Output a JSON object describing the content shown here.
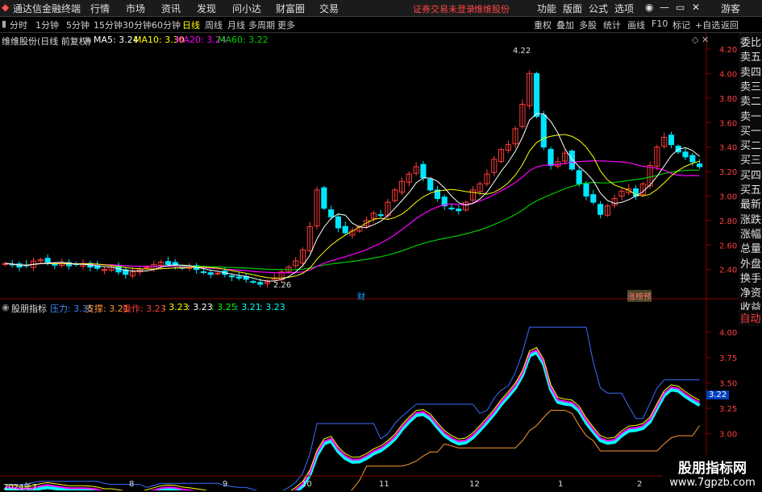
{
  "app": {
    "title": "通达信金融终端"
  },
  "menu": [
    "行情",
    "市场",
    "资讯",
    "发现",
    "问小达",
    "财富圈",
    "交易"
  ],
  "status_notice": "证券交易未登录",
  "stock_name": "维维股份",
  "menu_right": [
    "功能",
    "版面",
    "公式",
    "选项"
  ],
  "guest": "游客",
  "periods": [
    "分时",
    "1分钟",
    "5分钟",
    "15分钟",
    "30分钟",
    "60分钟",
    "日线",
    "周线",
    "月线",
    "多周期",
    "更多"
  ],
  "active_period": "日线",
  "tools": [
    "重权",
    "叠加",
    "多股",
    "统计",
    "画线",
    "F10",
    "标记",
    "+自选",
    "返回"
  ],
  "main_legend": {
    "title": "维维股份(日线 前复权)",
    "ma5": "MA5: 3.24",
    "ma10": "MA10: 3.30",
    "ma20": "MA20: 3.24",
    "ma60": "MA60: 3.22"
  },
  "sub_legend": {
    "title": "股朋指标",
    "pressure": "压力: 3.35",
    "support": "支撑: 3.21",
    "operate": "操作: 3.23",
    "v1": ": 3.23",
    "v2": ": 3.23",
    "v3": ": 3.25",
    "v4": ": 3.21",
    "v5": ": 3.23"
  },
  "right_panel": [
    "委比",
    "卖五",
    "卖四",
    "卖三",
    "卖二",
    "卖一",
    "买一",
    "买二",
    "买三",
    "买四",
    "买五",
    "最新",
    "涨跌",
    "涨幅",
    "总量",
    "外盘",
    "换手",
    "净资",
    "收益",
    "自动"
  ],
  "tags": {
    "cai": "财",
    "zhangting": "涨榜预",
    "high_label": "4.22",
    "low_label": "2.26",
    "sub_value": "3.22"
  },
  "x_labels": [
    "2024年7",
    "8",
    "9",
    "10",
    "11",
    "12",
    "1",
    "2"
  ],
  "watermark": {
    "line1": "股朋指标网",
    "line2": "www.7gpzb.com"
  },
  "colors": {
    "up": "#ff3b3b",
    "down": "#00e5ff",
    "ma5": "#ffffff",
    "ma10": "#ffff00",
    "ma20": "#ff00ff",
    "ma60": "#00cc00"
  },
  "chart_data": [
    {
      "type": "candlestick",
      "title": "维维股份(日线 前复权)",
      "ylim": [
        2.26,
        4.3
      ],
      "yticks": [
        2.4,
        2.6,
        2.8,
        3.0,
        3.2,
        3.4,
        3.6,
        3.8,
        4.0,
        4.2
      ],
      "high": 4.22,
      "low": 2.26,
      "close": [
        2.45,
        2.44,
        2.42,
        2.43,
        2.47,
        2.48,
        2.46,
        2.44,
        2.45,
        2.43,
        2.44,
        2.45,
        2.42,
        2.41,
        2.4,
        2.42,
        2.38,
        2.36,
        2.38,
        2.4,
        2.42,
        2.44,
        2.46,
        2.44,
        2.43,
        2.41,
        2.42,
        2.4,
        2.38,
        2.36,
        2.37,
        2.36,
        2.34,
        2.33,
        2.32,
        2.3,
        2.28,
        2.3,
        2.33,
        2.38,
        2.42,
        2.47,
        2.56,
        2.75,
        3.05,
        2.9,
        2.83,
        2.74,
        2.7,
        2.72,
        2.75,
        2.8,
        2.86,
        2.84,
        2.95,
        3.05,
        3.12,
        3.18,
        3.24,
        3.15,
        3.05,
        2.98,
        2.92,
        2.9,
        2.88,
        2.95,
        3.05,
        3.1,
        3.18,
        3.3,
        3.38,
        3.42,
        3.55,
        3.75,
        4.0,
        3.65,
        3.4,
        3.25,
        3.28,
        3.35,
        3.22,
        3.1,
        3.0,
        2.95,
        2.85,
        2.92,
        2.98,
        3.04,
        3.06,
        3.0,
        3.1,
        3.25,
        3.4,
        3.48,
        3.42,
        3.36,
        3.32,
        3.28,
        3.24
      ],
      "ma5": 3.24,
      "ma10": 3.3,
      "ma20": 3.24,
      "ma60": 3.22
    },
    {
      "type": "line",
      "title": "股朋指标",
      "ylim": [
        2.6,
        4.25
      ],
      "yticks": [
        2.75,
        3.0,
        3.25,
        3.5,
        3.75,
        4.0
      ],
      "series": [
        {
          "name": "压力",
          "last": 3.35
        },
        {
          "name": "支撑",
          "last": 3.21
        },
        {
          "name": "操作",
          "last": 3.23
        }
      ]
    }
  ]
}
